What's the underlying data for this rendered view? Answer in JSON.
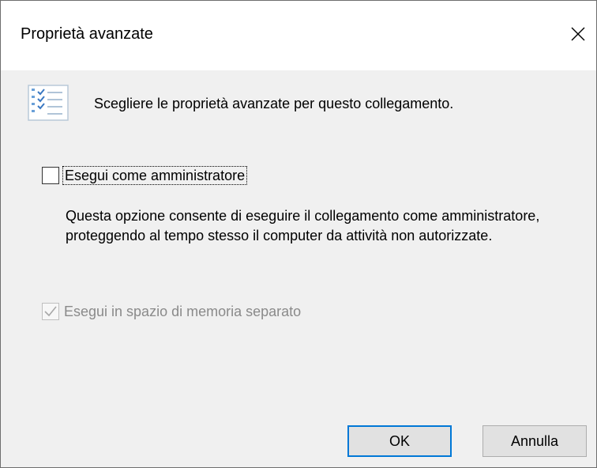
{
  "window": {
    "title": "Proprietà avanzate",
    "close_icon": "close-icon"
  },
  "header": {
    "icon": "properties-checklist-icon",
    "text": "Scegliere le proprietà avanzate per questo collegamento."
  },
  "run_as_admin": {
    "label": "Esegui come amministratore",
    "checked": false,
    "description": "Questa opzione consente di eseguire il collegamento come amministratore, proteggendo al tempo stesso il computer da attività non autorizzate."
  },
  "separate_memory": {
    "label": "Esegui in spazio di memoria separato",
    "checked": true,
    "enabled": false
  },
  "buttons": {
    "ok_label": "OK",
    "cancel_label": "Annulla"
  },
  "colors": {
    "accent": "#0078d7",
    "dialog_background": "#f0f0f0",
    "disabled_text": "#8a8a8a"
  }
}
